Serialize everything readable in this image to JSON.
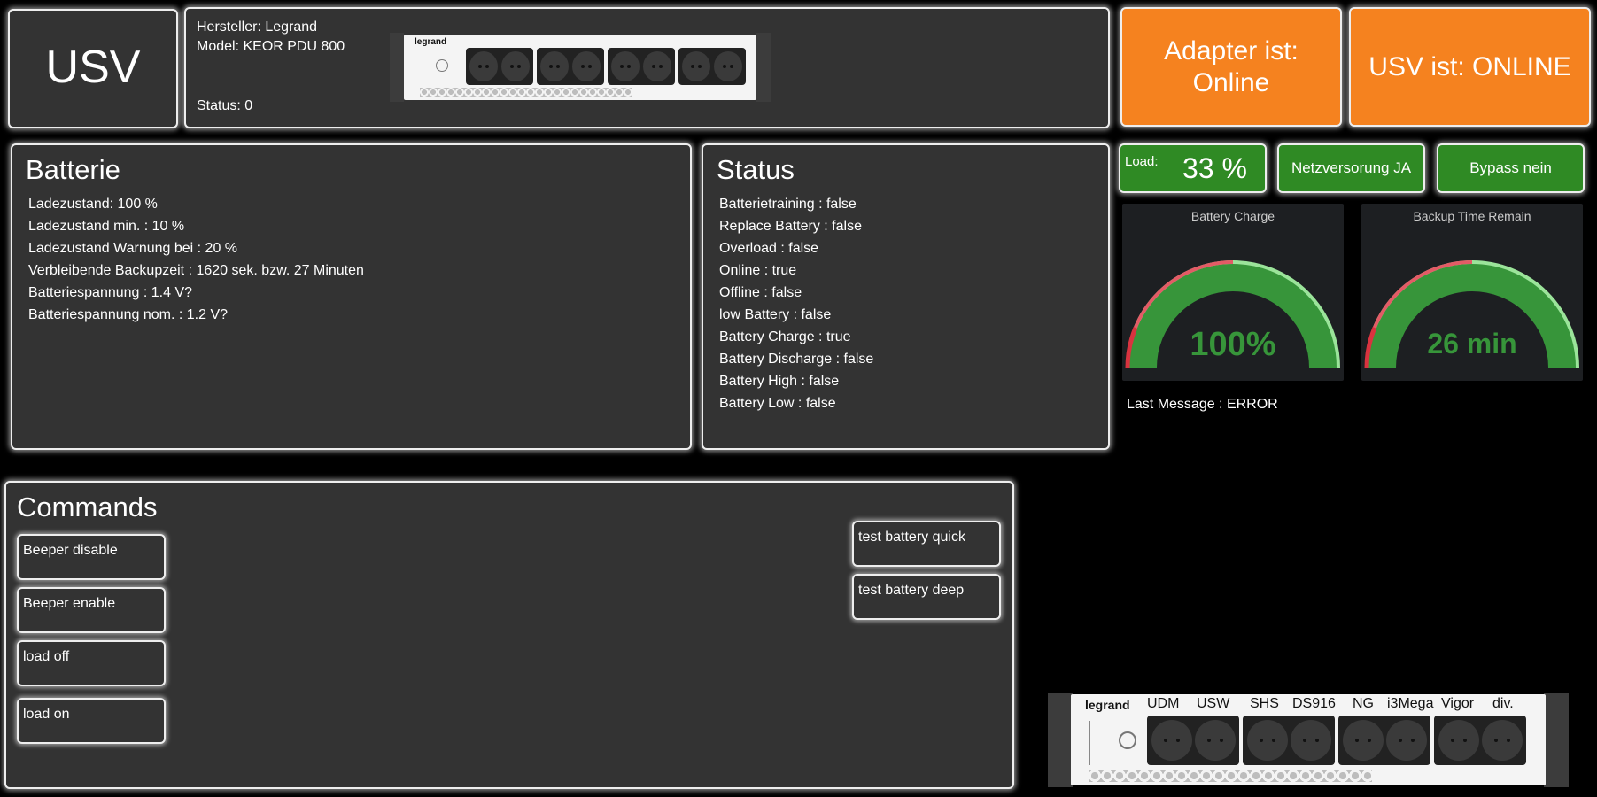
{
  "header": {
    "usv_label": "USV",
    "manufacturer": "Hersteller: Legrand",
    "model": "Model: KEOR PDU 800",
    "status": "Status: 0",
    "adapter_status": "Adapter ist: Online",
    "usv_status": "USV ist: ONLINE"
  },
  "battery": {
    "title": "Batterie",
    "lines": [
      "Ladezustand: 100 %",
      "Ladezustand min. : 10 %",
      "Ladezustand Warnung bei : 20 %",
      "Verbleibende Backupzeit : 1620 sek. bzw. 27 Minuten",
      "Batteriespannung : 1.4 V?",
      "Batteriespannung nom. : 1.2 V?"
    ]
  },
  "status_panel": {
    "title": "Status",
    "lines": [
      "Batterietraining : false",
      "Replace Battery : false",
      "Overload : false",
      "Online : true",
      "Offline : false",
      "low Battery : false",
      "Battery Charge : true",
      "Battery Discharge : false",
      "Battery High : false",
      "Battery Low : false"
    ]
  },
  "indicators": {
    "load_label": "Load:",
    "load_value": "33 %",
    "mains": "Netzversorung JA",
    "bypass": "Bypass nein"
  },
  "gauges": {
    "battery_charge": {
      "title": "Battery Charge",
      "value": "100%",
      "fraction": 1.0
    },
    "backup_time": {
      "title": "Backup Time Remain",
      "value": "26 min",
      "fraction": 1.0
    }
  },
  "last_message": "Last Message : ERROR",
  "commands": {
    "title": "Commands",
    "beeper_disable": "Beeper disable",
    "beeper_enable": "Beeper enable",
    "load_off": "load off",
    "load_on": "load on",
    "test_quick": "test battery quick",
    "test_deep": "test battery deep"
  },
  "pdu": {
    "brand": "legrand",
    "outlets": [
      "UDM",
      "USW",
      "SHS",
      "DS916",
      "NG",
      "i3Mega",
      "Vigor",
      "div."
    ]
  },
  "colors": {
    "orange": "#f5821f",
    "green": "#2f8a24",
    "panel": "#333333",
    "gauge_green": "#37953a",
    "gauge_red": "#d9333f"
  }
}
